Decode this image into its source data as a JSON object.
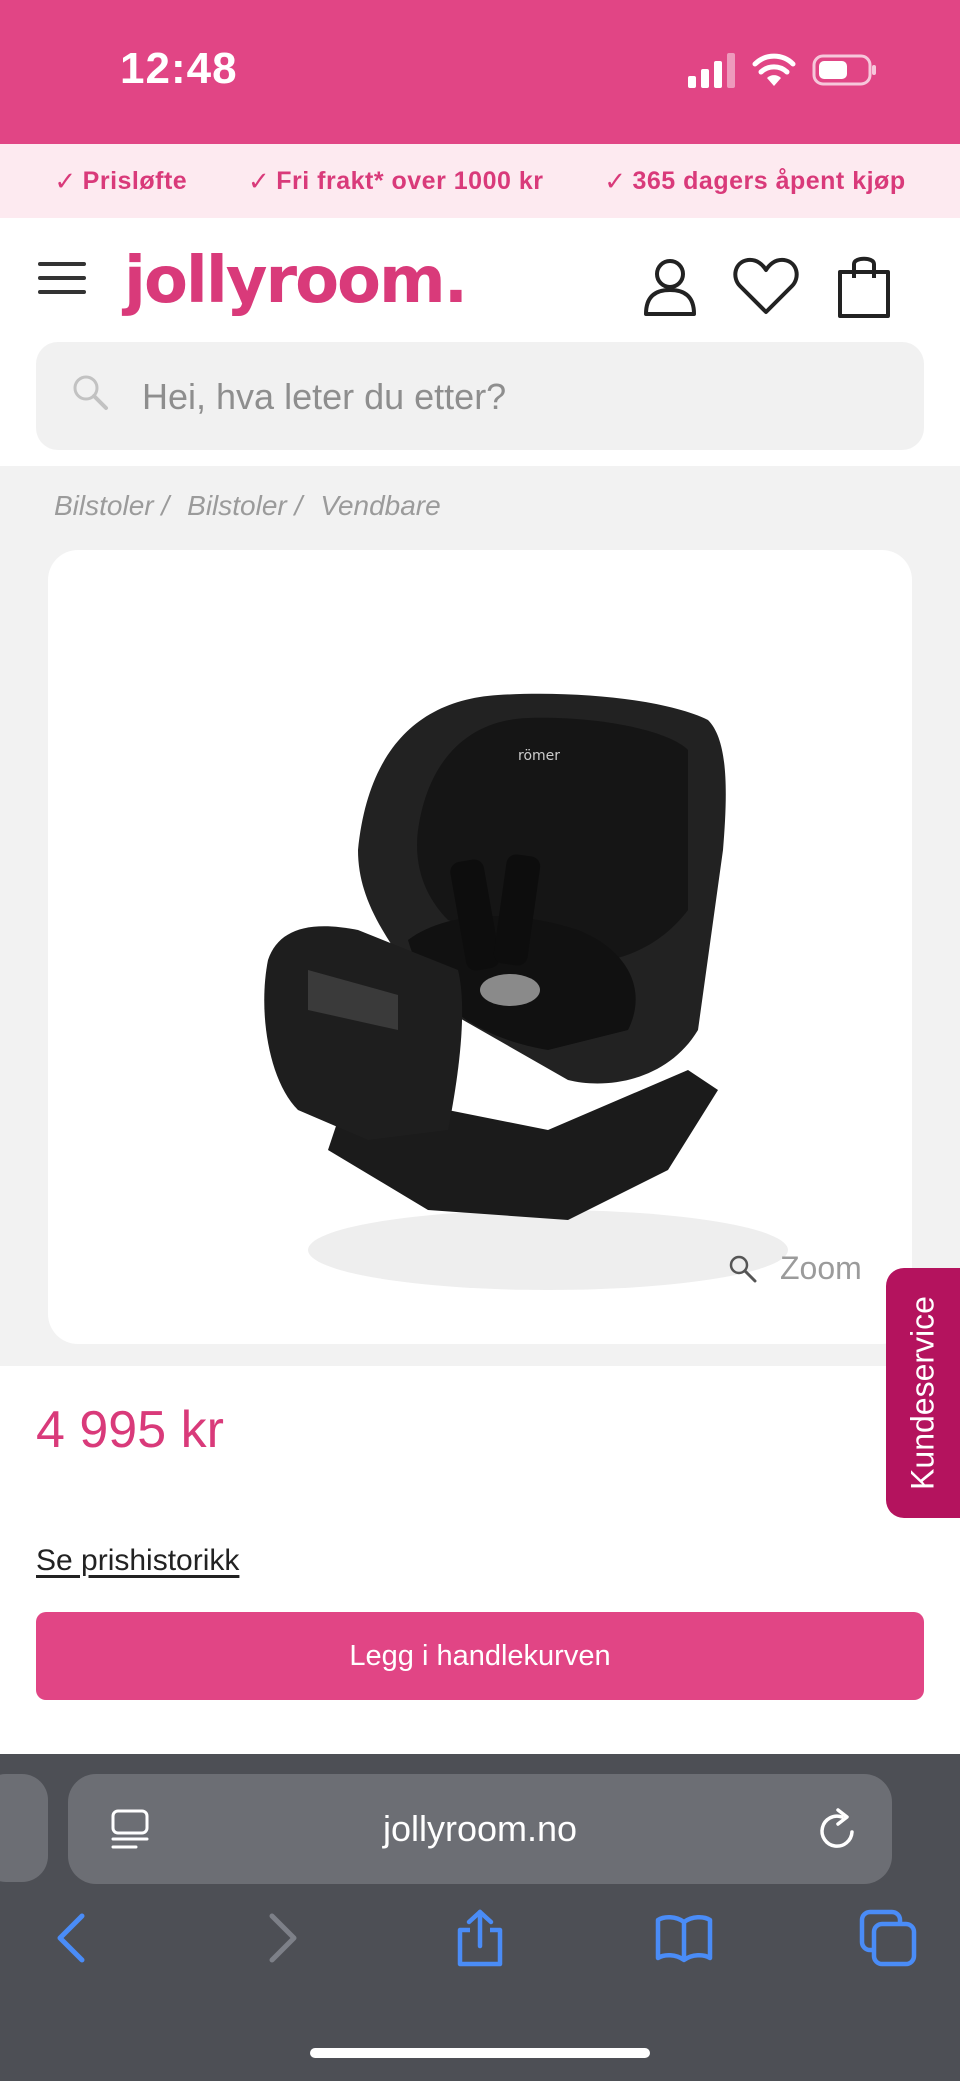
{
  "status": {
    "time": "12:48"
  },
  "promo": [
    {
      "check": "✓",
      "label": "Prisløfte"
    },
    {
      "check": "✓",
      "label": "Fri frakt* over 1000 kr"
    },
    {
      "check": "✓",
      "label": "365 dagers åpent kjøp"
    }
  ],
  "header": {
    "logo": "jollyroom.",
    "search_placeholder": "Hei, hva leter du etter?",
    "icons": [
      "menu-icon",
      "account-icon",
      "heart-icon",
      "shopping-bag-icon"
    ]
  },
  "breadcrumb": [
    "Bilstoler /",
    "Bilstoler /",
    "Vendbare"
  ],
  "product": {
    "zoom_label": "Zoom",
    "price": "4 995 kr",
    "price_history": "Se prishistorikk",
    "add_to_cart": "Legg i handlekurven"
  },
  "side_tab": {
    "label": "Kundeservice"
  },
  "browser": {
    "url": "jollyroom.no",
    "nav": [
      "back-icon",
      "forward-icon",
      "share-icon",
      "bookmarks-icon",
      "tabs-icon"
    ]
  },
  "colors": {
    "brand_pink": "#e14585",
    "brand_text_pink": "#d93a7a",
    "side_tab": "#b4135e",
    "promo_bg": "#fdeaf0",
    "ios_blue": "#4a8cf7"
  }
}
